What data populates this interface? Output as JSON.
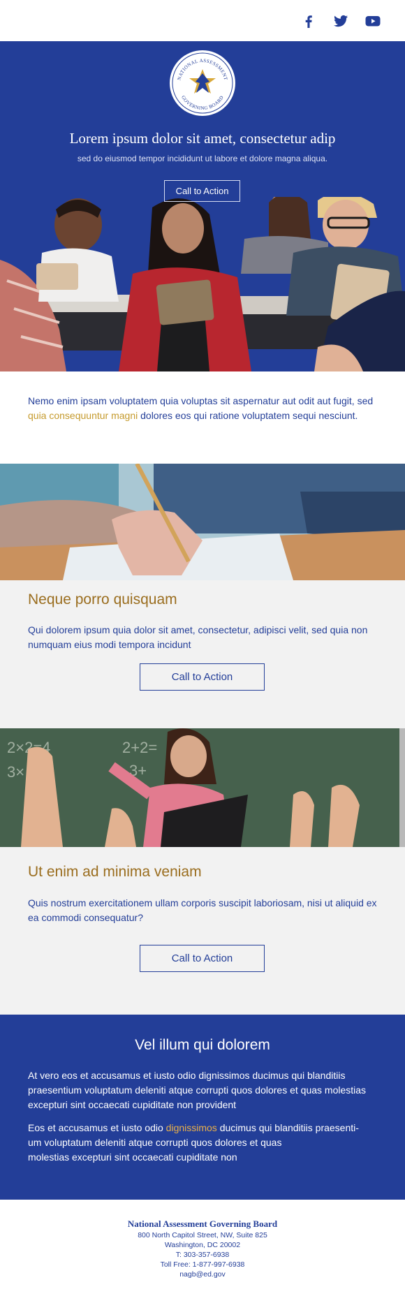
{
  "header": {
    "logo_text_top": "NATIONAL ASSESSMENT",
    "logo_text_bottom": "GOVERNING BOARD",
    "social": [
      {
        "icon": "facebook-icon"
      },
      {
        "icon": "twitter-icon"
      },
      {
        "icon": "youtube-icon"
      }
    ]
  },
  "hero": {
    "title": "Lorem ipsum dolor sit amet, consectetur adip",
    "subtitle": "sed do eiusmod tempor incididunt ut labore et dolore magna aliqua.",
    "cta_label": "Call to Action"
  },
  "intro": {
    "text_before": "Nemo enim ipsam voluptatem quia voluptas sit aspernatur aut odit aut fugit, sed ",
    "highlight": "quia consequuntur magni",
    "text_after": " dolores eos qui ratione voluptatem sequi nesciunt."
  },
  "section1": {
    "title": "Neque porro quisquam",
    "text": "Qui dolorem ipsum quia dolor sit amet, consectetur, adipisci velit, sed quia non numquam eius modi tempora incidunt",
    "cta_label": "Call to Action"
  },
  "section2": {
    "title": "Ut enim ad minima veniam",
    "text": "Quis nostrum exercitationem ullam corporis suscipit laboriosam, nisi ut aliquid ex ea commodi consequatur?",
    "cta_label": "Call to Action"
  },
  "band": {
    "title": "Vel illum qui dolorem",
    "para1": "At vero eos et accusamus et iusto odio dignissimos ducimus qui blanditiis praesentium voluptatum deleniti atque corrupti quos dolores et quas molestias excepturi sint occaecati cupiditate non provident",
    "para2_before": "Eos et accusamus et iusto odio ",
    "para2_highlight": "dignissimos",
    "para2_line1_after": " ducimus qui blanditiis praesenti-",
    "para2_line2": "um voluptatum deleniti atque corrupti quos dolores et quas",
    "para2_line3": "molestias excepturi sint occaecati cupiditate non"
  },
  "footer": {
    "org": "National Assessment Governing Board",
    "address1": "800 North Capitol Street, NW, Suite 825",
    "address2": "Washington, DC 20002",
    "phone": "T: 303-357-6938",
    "tollfree": "Toll Free: 1-877-997-6938",
    "email": "nagb@ed.gov"
  },
  "colors": {
    "brand_blue": "#233e98",
    "gold_heading": "#9a6d1e",
    "gold_highlight": "#c59a2c",
    "section_bg": "#f2f2f2"
  }
}
